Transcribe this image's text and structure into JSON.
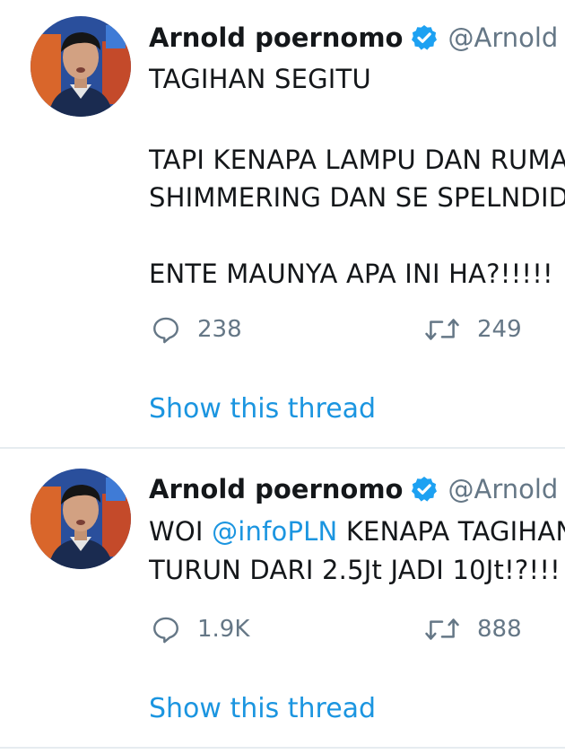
{
  "tweets": [
    {
      "name": "Arnold poernomo",
      "handle": "@Arnold",
      "lines": [
        "TAGIHAN SEGITU",
        "",
        "TAPI KENAPA LAMPU DAN RUMAH",
        "SHIMMERING DAN SE SPELNDID",
        "",
        "ENTE MAUNYA APA INI HA?!!!!!"
      ],
      "replies": "238",
      "retweets": "249",
      "thread_link": "Show this thread"
    },
    {
      "name": "Arnold poernomo",
      "handle": "@Arnold",
      "text_prefix": "WOI ",
      "mention": "@infoPLN",
      "text_suffix": " KENAPA TAGIHAN",
      "line2": "TURUN DARI 2.5Jt JADI 10Jt!?!!!",
      "replies": "1.9K",
      "retweets": "888",
      "thread_link": "Show this thread"
    }
  ],
  "icons": {
    "reply": "reply-icon",
    "retweet": "retweet-icon",
    "verified": "verified-badge-icon"
  },
  "colors": {
    "link": "#1b95e0",
    "verified": "#1da1f2",
    "secondary": "#657786",
    "separator": "#e6ecf0"
  }
}
